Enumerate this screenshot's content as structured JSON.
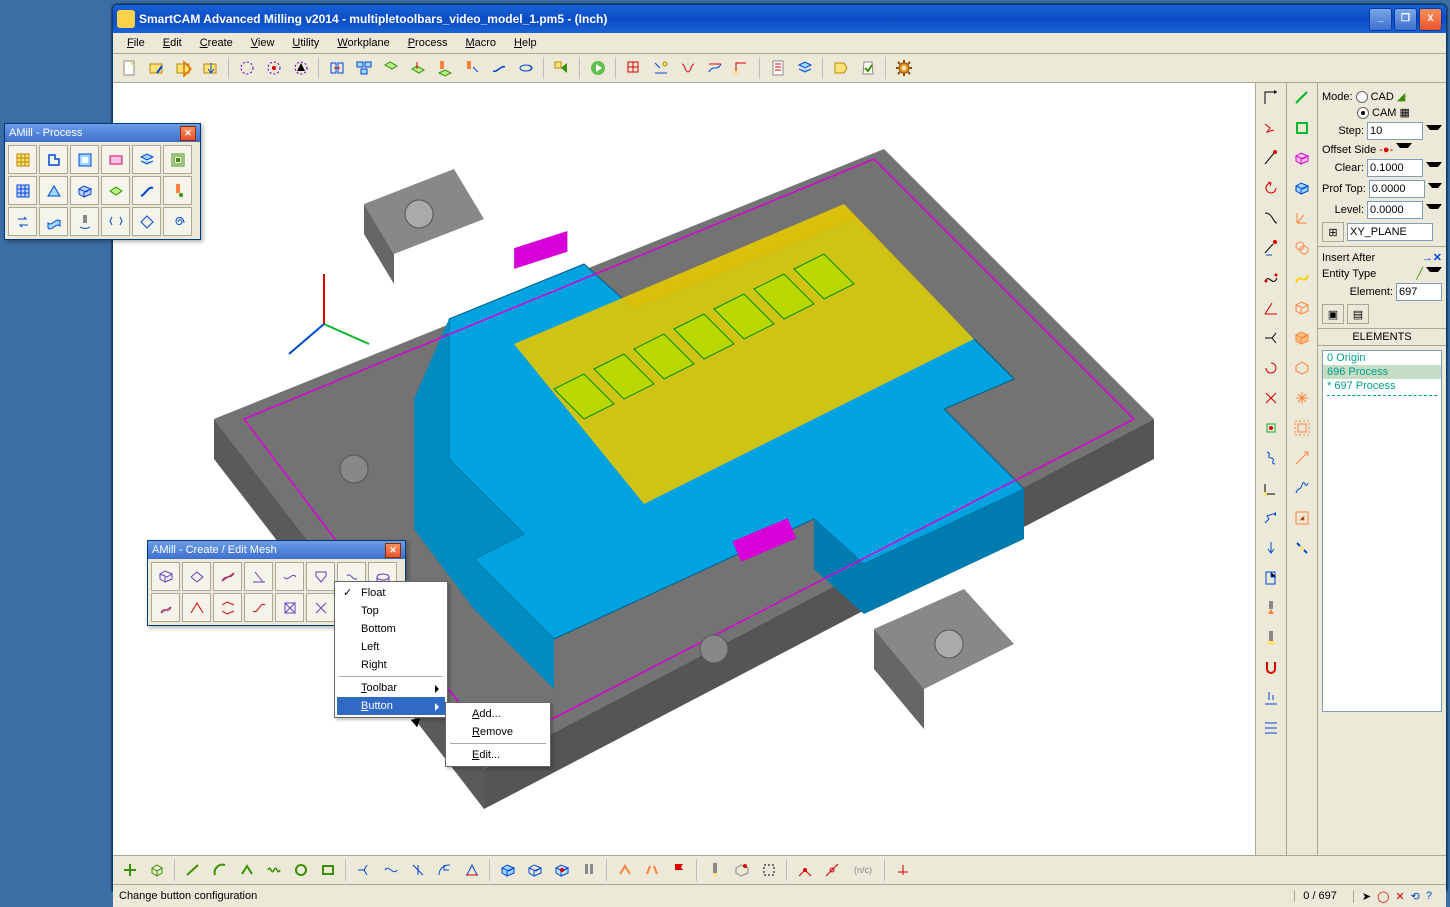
{
  "window": {
    "title": "SmartCAM Advanced Milling v2014 - multipletoolbars_video_model_1.pm5 - (Inch)",
    "min": "_",
    "max": "❐",
    "close": "X"
  },
  "menu": {
    "file": "File",
    "edit": "Edit",
    "create": "Create",
    "view": "View",
    "utility": "Utility",
    "workplane": "Workplane",
    "process": "Process",
    "macro": "Macro",
    "help": "Help"
  },
  "panel": {
    "mode_label": "Mode:",
    "cad_label": "CAD",
    "cam_label": "CAM",
    "step_label": "Step:",
    "step_value": "10",
    "offset_label": "Offset Side",
    "clear_label": "Clear:",
    "clear_value": "0.1000",
    "proftop_label": "Prof Top:",
    "proftop_value": "0.0000",
    "level_label": "Level:",
    "level_value": "0.0000",
    "xy_plane": "XY_PLANE",
    "insert_after": "Insert After",
    "entity_type": "Entity Type",
    "element_label": "Element:",
    "element_value": "697",
    "elements_header": "ELEMENTS",
    "elem_origin": "0 Origin",
    "elem_696": "696 Process",
    "elem_697": "* 697 Process"
  },
  "float_process": {
    "title": "AMill - Process"
  },
  "float_mesh": {
    "title": "AMill - Create / Edit Mesh"
  },
  "context1": {
    "float": "Float",
    "top": "Top",
    "bottom": "Bottom",
    "left": "Left",
    "right": "Right",
    "toolbar": "Toolbar",
    "button": "Button"
  },
  "context2": {
    "add": "Add...",
    "remove": "Remove",
    "edit": "Edit..."
  },
  "status": {
    "message": "Change button configuration",
    "counter": "0 / 697"
  },
  "toolbar_icons": {
    "n1": "new-file-icon",
    "n2": "open-icon",
    "n3": "explorer-icon",
    "n4": "save-icon",
    "n5": "undo-icon",
    "n6": "redo-icon",
    "n7": "select-icon",
    "n8": "select-box-icon",
    "n9": "layers-icon",
    "n10": "tool-icon",
    "n11": "tool2-icon",
    "n12": "align-icon",
    "n13": "measure-icon",
    "n14": "curve-icon",
    "n15": "combine-icon",
    "n16": "match-icon",
    "n17": "snap-icon",
    "n18": "profile-icon",
    "n19": "loop-icon",
    "n20": "convert-icon",
    "n21": "group-icon",
    "n22": "rename-icon",
    "n23": "path-icon",
    "n24": "wave-icon",
    "n25": "spiral-icon",
    "n26": "grid-icon",
    "n27": "layers2-icon",
    "n28": "order-icon",
    "n29": "check-icon",
    "n30": "gear-icon"
  }
}
